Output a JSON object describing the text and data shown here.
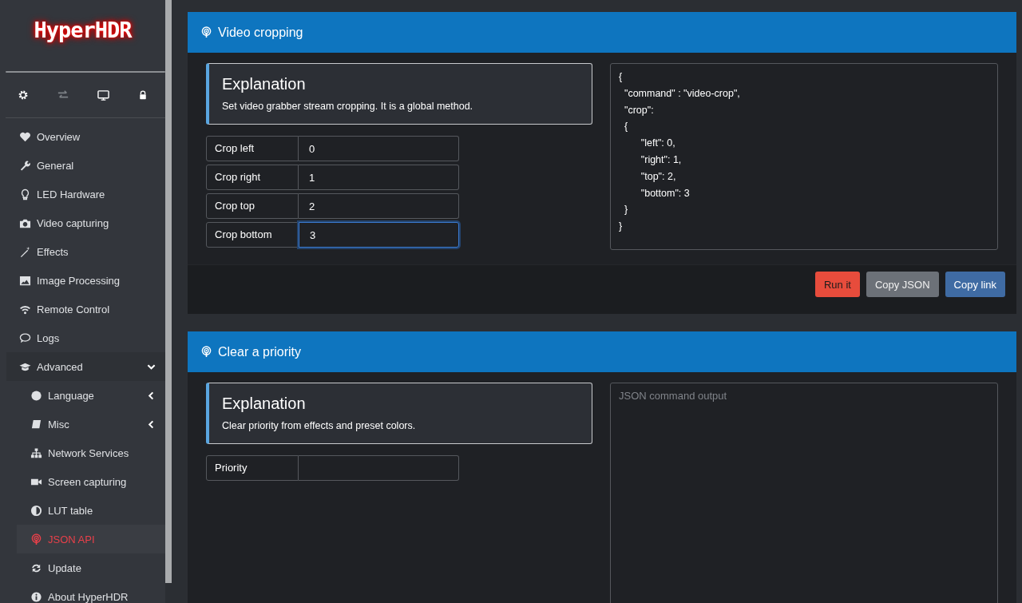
{
  "logo": "HyperHDR",
  "nav": [
    {
      "label": "Overview",
      "selected": false
    },
    {
      "label": "General",
      "selected": false
    },
    {
      "label": "LED Hardware",
      "selected": false
    },
    {
      "label": "Video capturing",
      "selected": false
    },
    {
      "label": "Effects",
      "selected": false
    },
    {
      "label": "Image Processing",
      "selected": false
    },
    {
      "label": "Remote Control",
      "selected": false
    },
    {
      "label": "Logs",
      "selected": false
    },
    {
      "label": "Advanced",
      "selected": false,
      "expanded": true,
      "children": [
        {
          "label": "Language",
          "selected": false,
          "expanded": false,
          "has_children": true
        },
        {
          "label": "Misc",
          "selected": false,
          "expanded": false,
          "has_children": true
        },
        {
          "label": "Network Services",
          "selected": false
        },
        {
          "label": "Screen capturing",
          "selected": false
        },
        {
          "label": "LUT table",
          "selected": false
        },
        {
          "label": "JSON API",
          "selected": true
        },
        {
          "label": "Update",
          "selected": false
        },
        {
          "label": "About HyperHDR",
          "selected": false
        }
      ]
    }
  ],
  "sections": [
    {
      "title": "Video cropping",
      "explanation_title": "Explanation",
      "explanation_text": "Set video grabber stream cropping. It is a global method.",
      "fields": [
        {
          "label": "Crop left",
          "value": "0",
          "focused": false
        },
        {
          "label": "Crop right",
          "value": "1",
          "focused": false
        },
        {
          "label": "Crop top",
          "value": "2",
          "focused": false
        },
        {
          "label": "Crop bottom",
          "value": "3",
          "focused": true
        }
      ],
      "command": "{\n  \"command\" : \"video-crop\",\n  \"crop\":\n  {\n        \"left\": 0,\n        \"right\": 1,\n        \"top\": 2,\n        \"bottom\": 3\n  }\n}",
      "buttons": [
        {
          "label": "Run it",
          "kind": "danger"
        },
        {
          "label": "Copy JSON",
          "kind": "secondary"
        },
        {
          "label": "Copy link",
          "kind": "primary"
        }
      ]
    },
    {
      "title": "Clear a priority",
      "explanation_title": "Explanation",
      "explanation_text": "Clear priority from effects and preset colors.",
      "fields": [
        {
          "label": "Priority",
          "focused": false
        }
      ],
      "output_placeholder": "JSON command output"
    }
  ]
}
